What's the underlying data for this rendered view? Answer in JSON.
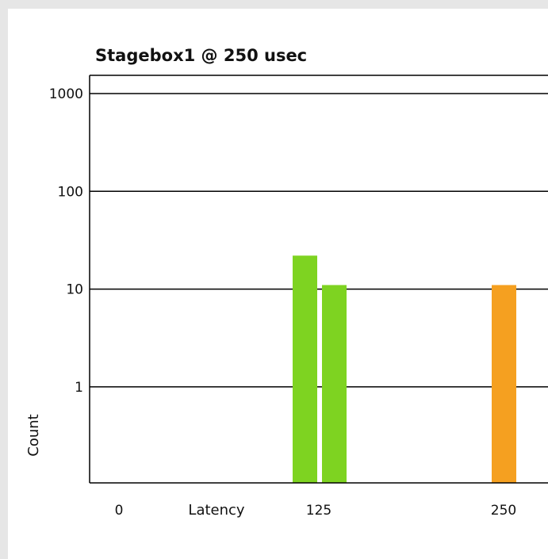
{
  "chart_data": {
    "type": "bar",
    "title": "Stagebox1 @ 250 usec",
    "xlabel": "Latency",
    "ylabel": "Count",
    "y_scale": "log",
    "ylim": [
      0.1,
      1000
    ],
    "y_ticks": [
      1,
      10,
      100,
      1000
    ],
    "y_tick_labels": [
      "1",
      "10",
      "100",
      "1000"
    ],
    "x_tick_labels": [
      "0",
      "125",
      "250"
    ],
    "grid": true,
    "bars": [
      {
        "x": 125,
        "value": 22,
        "color": "#7ed321"
      },
      {
        "x": 125,
        "value": 11,
        "color": "#7ed321"
      },
      {
        "x": 250,
        "value": 11,
        "color": "#f5a020"
      }
    ]
  }
}
